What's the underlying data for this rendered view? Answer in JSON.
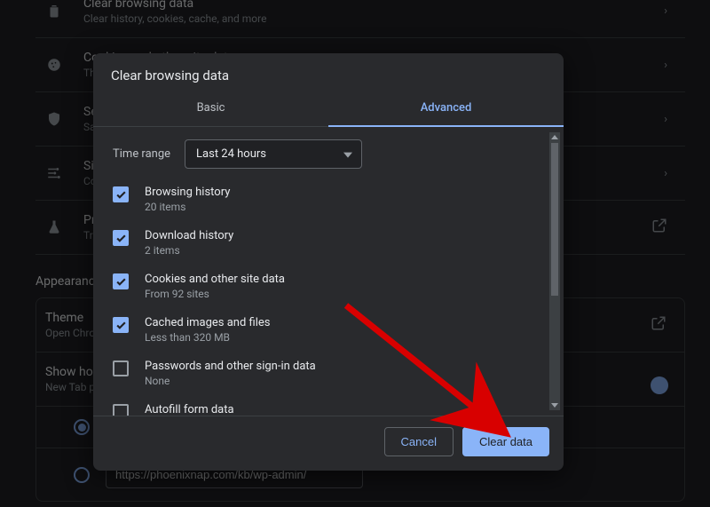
{
  "bg": {
    "rows": [
      {
        "title": "Clear browsing data",
        "sub": "Clear history, cookies, cache, and more"
      },
      {
        "title": "Cookies and other site data",
        "sub": "Third-party cookies are blocked in Incognito mode"
      },
      {
        "title": "Security",
        "sub": "Safe Browsing (protection from dangerous sites) and other security settings"
      },
      {
        "title": "Site Settings",
        "sub": "Controls what information sites can use and show"
      },
      {
        "title": "Privacy Sandbox",
        "sub": "Trial features are on"
      }
    ],
    "appearance": "Appearance",
    "card": [
      {
        "title": "Theme",
        "sub": "Open Chrome Web Store"
      },
      {
        "title": "Show home button",
        "sub": "New Tab page"
      }
    ],
    "url": "https://phoenixnap.com/kb/wp-admin/"
  },
  "modal": {
    "title": "Clear browsing data",
    "tabs": [
      "Basic",
      "Advanced"
    ],
    "range_label": "Time range",
    "range_value": "Last 24 hours",
    "options": [
      {
        "title": "Browsing history",
        "sub": "20 items"
      },
      {
        "title": "Download history",
        "sub": "2 items"
      },
      {
        "title": "Cookies and other site data",
        "sub": "From 92 sites"
      },
      {
        "title": "Cached images and files",
        "sub": "Less than 320 MB"
      },
      {
        "title": "Passwords and other sign-in data",
        "sub": "None"
      },
      {
        "title": "Autofill form data"
      }
    ],
    "cancel": "Cancel",
    "confirm": "Clear data"
  }
}
